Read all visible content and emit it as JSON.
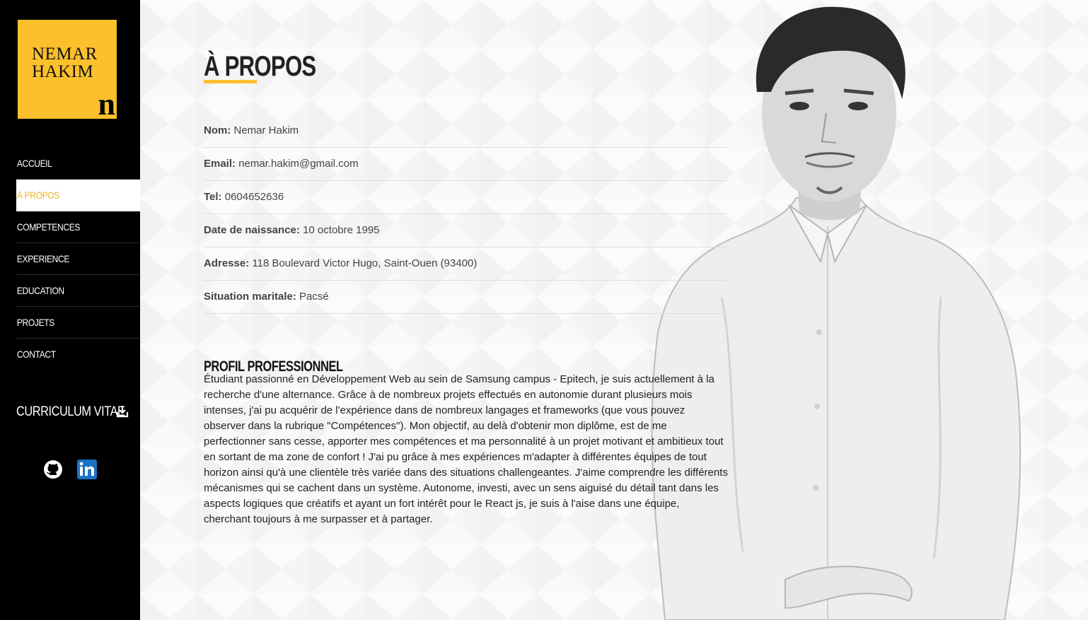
{
  "logo": {
    "line1": "NEMAR",
    "line2": "HAKIM",
    "mark": "n"
  },
  "nav": [
    {
      "label": "ACCUEIL"
    },
    {
      "label": "À PROPOS",
      "active": true
    },
    {
      "label": "COMPETENCES"
    },
    {
      "label": "EXPERIENCE"
    },
    {
      "label": "EDUCATION"
    },
    {
      "label": "PROJETS"
    },
    {
      "label": "CONTACT"
    }
  ],
  "cv": {
    "label": "CURRICULUM VITAE",
    "icon": "download-icon"
  },
  "social": [
    {
      "icon": "github-icon"
    },
    {
      "icon": "linkedin-icon"
    }
  ],
  "page": {
    "title": "À PROPOS"
  },
  "info": [
    {
      "label": "Nom:",
      "value": "Nemar Hakim"
    },
    {
      "label": "Email:",
      "value": "nemar.hakim@gmail.com"
    },
    {
      "label": "Tel:",
      "value": "0604652636"
    },
    {
      "label": "Date de naissance:",
      "value": "10 octobre 1995"
    },
    {
      "label": "Adresse:",
      "value": "118 Boulevard Victor Hugo, Saint-Ouen (93400)"
    },
    {
      "label": "Situation maritale:",
      "value": "Pacsé"
    }
  ],
  "profile": {
    "title": "PROFIL PROFESSIONNEL",
    "text": "Étudiant passionné en Développement Web au sein de Samsung campus - Epitech, je suis actuellement à la recherche d'une alternance. Grâce à de nombreux projets effectués en autonomie durant plusieurs mois intenses, j'ai pu acquérir de l'expérience dans de nombreux langages et frameworks (que vous pouvez observer dans la rubrique \"Compétences\"). Mon objectif, au delà d'obtenir mon diplôme, est de me perfectionner sans cesse, apporter mes compétences et ma personnalité à un projet motivant et ambitieux tout en sortant de ma zone de confort ! J'ai pu grâce à mes expériences m'adapter à différentes équipes de tout horizon ainsi qu'à une clientèle très variée dans des situations challengeantes. J'aime comprendre les différents mécanismes qui se cachent dans un système. Autonome, investi, avec un sens aiguisé du détail tant dans les aspects logiques que créatifs et ayant un fort intérêt pour le React js, je suis à l'aise dans une équipe, cherchant toujours à me surpasser et à partager."
  },
  "colors": {
    "accent": "#fcc02d",
    "sidebar": "#000000",
    "active_text": "#f0b429"
  }
}
